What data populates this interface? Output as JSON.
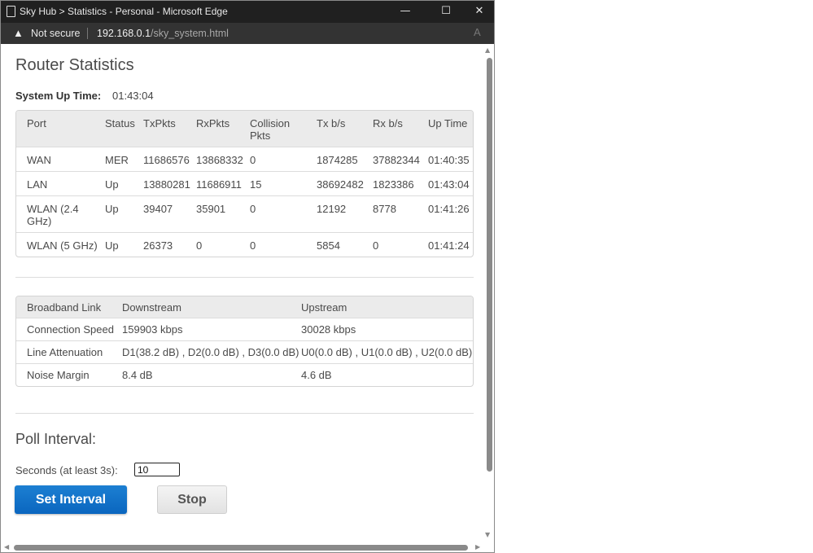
{
  "window": {
    "title": "Sky Hub > Statistics - Personal - Microsoft Edge",
    "minimize_glyph": "—",
    "maximize_glyph": "☐",
    "close_glyph": "✕"
  },
  "addressbar": {
    "warning_glyph": "▲",
    "security_label": "Not secure",
    "url_host": "192.168.0.1",
    "url_path": "/sky_system.html",
    "read_aloud_glyph": "A"
  },
  "page": {
    "title": "Router Statistics",
    "uptime_label": "System Up Time:",
    "uptime_value": "01:43:04"
  },
  "port_table": {
    "headers": [
      "Port",
      "Status",
      "TxPkts",
      "RxPkts",
      "Collision Pkts",
      "Tx b/s",
      "Rx b/s",
      "Up Time"
    ],
    "rows": [
      [
        "WAN",
        "MER",
        "11686576",
        "13868332",
        "0",
        "1874285",
        "37882344",
        "01:40:35"
      ],
      [
        "LAN",
        "Up",
        "13880281",
        "11686911",
        "15",
        "38692482",
        "1823386",
        "01:43:04"
      ],
      [
        "WLAN (2.4 GHz)",
        "Up",
        "39407",
        "35901",
        "0",
        "12192",
        "8778",
        "01:41:26"
      ],
      [
        "WLAN (5 GHz)",
        "Up",
        "26373",
        "0",
        "0",
        "5854",
        "0",
        "01:41:24"
      ]
    ]
  },
  "broadband_table": {
    "headers": [
      "Broadband Link",
      "Downstream",
      "Upstream"
    ],
    "rows": [
      [
        "Connection Speed",
        "159903 kbps",
        "30028 kbps"
      ],
      [
        "Line Attenuation",
        "D1(38.2 dB) , D2(0.0 dB) , D3(0.0 dB)",
        "U0(0.0 dB) , U1(0.0 dB) , U2(0.0 dB)"
      ],
      [
        "Noise Margin",
        "8.4 dB",
        "4.6 dB"
      ]
    ]
  },
  "poll": {
    "title": "Poll Interval:",
    "seconds_label": "Seconds (at least 3s):",
    "seconds_value": "10",
    "set_button": "Set Interval",
    "stop_button": "Stop"
  },
  "scrollbars": {
    "up_glyph": "▲",
    "down_glyph": "▼",
    "left_glyph": "◀",
    "right_glyph": "▶"
  }
}
